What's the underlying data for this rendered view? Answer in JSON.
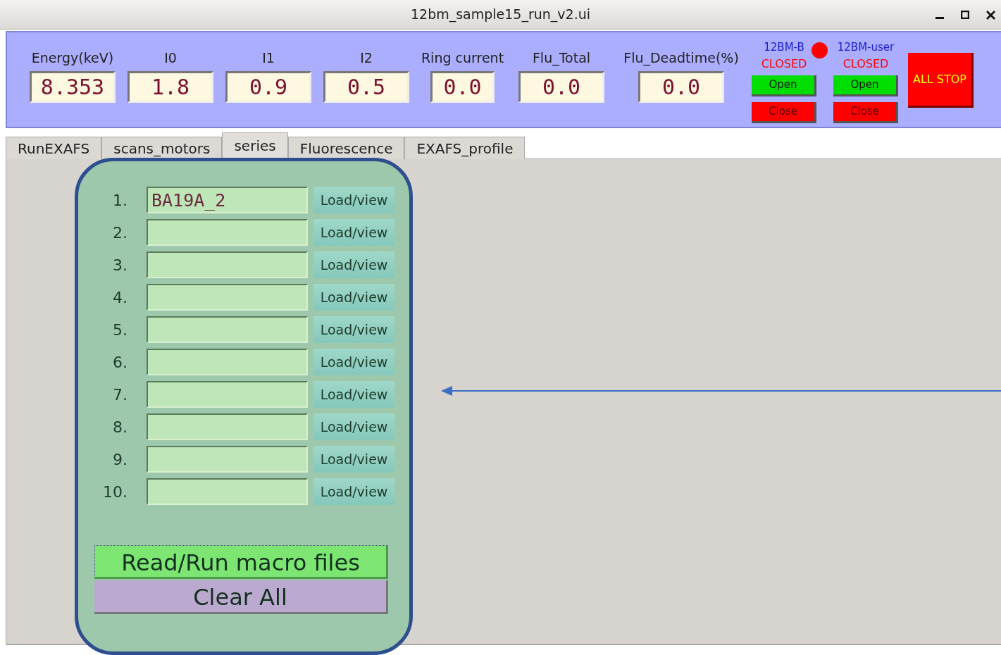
{
  "window": {
    "title": "12bm_sample15_run_v2.ui"
  },
  "readouts": [
    {
      "label": "Energy(keV)",
      "value": "8.353"
    },
    {
      "label": "I0",
      "value": "1.8"
    },
    {
      "label": "I1",
      "value": "0.9"
    },
    {
      "label": "I2",
      "value": "0.5"
    },
    {
      "label": "Ring current",
      "value": "0.0"
    },
    {
      "label": "Flu_Total",
      "value": "0.0"
    },
    {
      "label": "Flu_Deadtime(%)",
      "value": "0.0"
    }
  ],
  "shutters": [
    {
      "name": "12BM-B",
      "status": "CLOSED",
      "indicator": true,
      "open_label": "Open",
      "close_label": "Close"
    },
    {
      "name": "12BM-user",
      "status": "CLOSED",
      "indicator": false,
      "open_label": "Open",
      "close_label": "Close"
    }
  ],
  "all_stop": "ALL STOP",
  "tabs": [
    {
      "label": "RunEXAFS",
      "selected": false
    },
    {
      "label": "scans_motors",
      "selected": false
    },
    {
      "label": "series",
      "selected": true
    },
    {
      "label": "Fluorescence",
      "selected": false
    },
    {
      "label": "EXAFS_profile",
      "selected": false
    }
  ],
  "series": {
    "rows": [
      {
        "number": "1.",
        "value": "BA19A_2",
        "button": "Load/view"
      },
      {
        "number": "2.",
        "button": "Load/view"
      },
      {
        "number": "3.",
        "button": "Load/view"
      },
      {
        "number": "4.",
        "button": "Load/view"
      },
      {
        "number": "5.",
        "button": "Load/view"
      },
      {
        "number": "6.",
        "button": "Load/view"
      },
      {
        "number": "7.",
        "button": "Load/view"
      },
      {
        "number": "8.",
        "button": "Load/view"
      },
      {
        "number": "9.",
        "button": "Load/view"
      },
      {
        "number": "10.",
        "button": "Load/view"
      }
    ],
    "buttons": [
      {
        "kind": "run",
        "label": "Read/Run macro files"
      },
      {
        "kind": "clear",
        "label": "Clear All"
      }
    ]
  }
}
